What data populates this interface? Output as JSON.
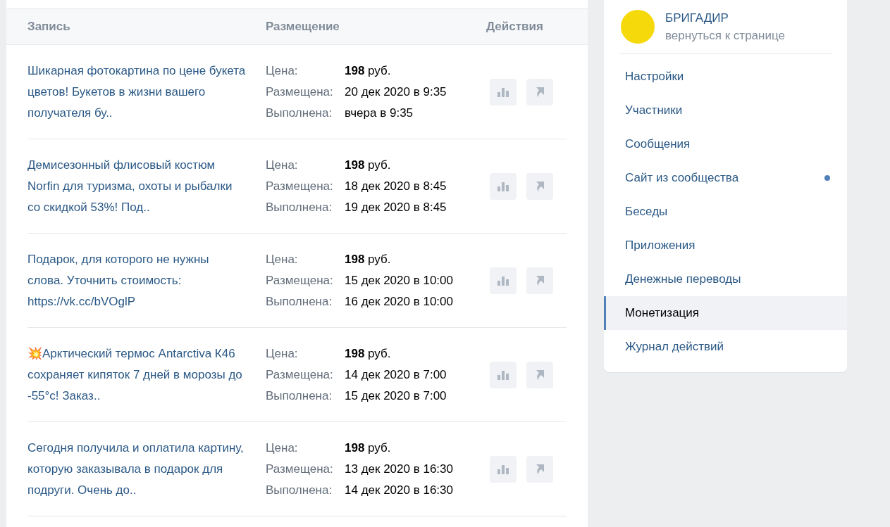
{
  "table": {
    "columns": [
      "Запись",
      "Размещение",
      "Действия"
    ],
    "rows": [
      {
        "title": "Шикарная фотокартина по цене букета цветов! Букетов в жизни вашего получателя бу..",
        "price_label": "Цена:",
        "price": "**198** руб.",
        "placed_label": "Размещена:",
        "placed": "20 дек 2020 в 9:35",
        "done_label": "Выполнена:",
        "done": "вчера в 9:35"
      },
      {
        "title": "Демисезонный флисовый костюм Norfin для туризма, охоты и рыбалки со скидкой 53%! Под..",
        "price_label": "Цена:",
        "price": "**198** руб.",
        "placed_label": "Размещена:",
        "placed": "18 дек 2020 в 8:45",
        "done_label": "Выполнена:",
        "done": "19 дек 2020 в 8:45"
      },
      {
        "title": "Подарок, для которого не нужны слова. Уточнить стоимость: https://vk.cc/bVOglP",
        "price_label": "Цена:",
        "price": "**198** руб.",
        "placed_label": "Размещена:",
        "placed": "15 дек 2020 в 10:00",
        "done_label": "Выполнена:",
        "done": "16 дек 2020 в 10:00"
      },
      {
        "title": "💥Арктический термос Antarctiva К46 сохраняет кипяток 7 дней в морозы до -55°с! Заказ..",
        "price_label": "Цена:",
        "price": "**198** руб.",
        "placed_label": "Размещена:",
        "placed": "14 дек 2020 в 7:00",
        "done_label": "Выполнена:",
        "done": "15 дек 2020 в 7:00"
      },
      {
        "title": "Сегодня получила и оплатила картину, которую заказывала в подарок для подруги. Очень до..",
        "price_label": "Цена:",
        "price": "**198** руб.",
        "placed_label": "Размещена:",
        "placed": "13 дек 2020 в 16:30",
        "done_label": "Выполнена:",
        "done": "14 дек 2020 в 16:30"
      }
    ]
  },
  "sidebar": {
    "community": {
      "name": "БРИГАДИР",
      "link": "вернуться к странице"
    },
    "items": [
      {
        "label": "Настройки",
        "selected": false,
        "dot": false
      },
      {
        "label": "Участники",
        "selected": false,
        "dot": false
      },
      {
        "label": "Сообщения",
        "selected": false,
        "dot": false
      },
      {
        "label": "Сайт из сообщества",
        "selected": false,
        "dot": true
      },
      {
        "label": "Беседы",
        "selected": false,
        "dot": false
      },
      {
        "label": "Приложения",
        "selected": false,
        "dot": false
      },
      {
        "label": "Денежные переводы",
        "selected": false,
        "dot": false
      },
      {
        "label": "Монетизация",
        "selected": true,
        "dot": false
      },
      {
        "label": "Журнал действий",
        "selected": false,
        "dot": false
      }
    ]
  }
}
